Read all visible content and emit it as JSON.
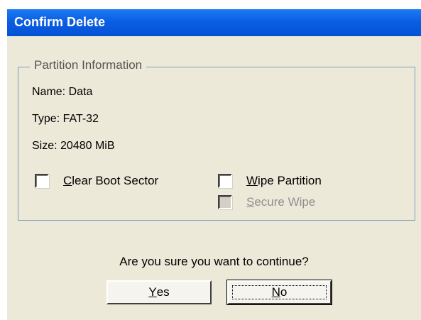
{
  "dialog": {
    "title": "Confirm Delete"
  },
  "partition_info": {
    "group_title": "Partition Information",
    "name_line": "Name: Data",
    "type_line": "Type: FAT-32",
    "size_line": "Size: 20480 MiB"
  },
  "options": {
    "clear_boot_sector": {
      "accel": "C",
      "rest": "lear Boot Sector",
      "checked": false,
      "enabled": true
    },
    "wipe_partition": {
      "accel": "W",
      "rest": "ipe Partition",
      "checked": false,
      "enabled": true
    },
    "secure_wipe": {
      "accel": "S",
      "rest": "ecure Wipe",
      "checked": false,
      "enabled": false
    }
  },
  "prompt": "Are you sure you want to continue?",
  "buttons": {
    "yes": {
      "accel": "Y",
      "rest": "es"
    },
    "no": {
      "accel": "N",
      "rest": "o"
    }
  },
  "colors": {
    "title_bar": "#0a5ee2",
    "dialog_background": "#ece9d8",
    "groupbox_border": "#7f9db9",
    "disabled_text": "#8f8f8f"
  }
}
